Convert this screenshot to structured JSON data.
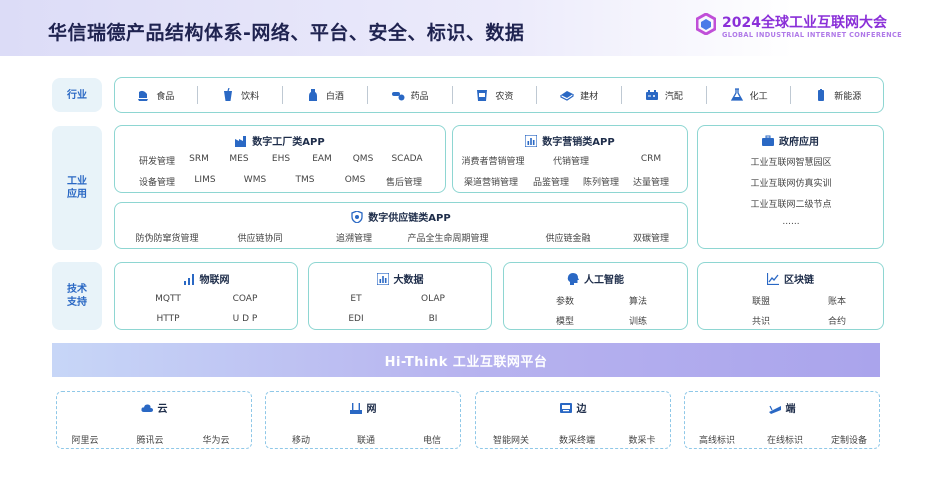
{
  "header": {
    "title": "华信瑞德产品结构体系-网络、平台、安全、标识、数据",
    "conference_title": "2024全球工业互联网大会",
    "conference_subtitle": "GLOBAL INDUSTRIAL INTERNET CONFERENCE"
  },
  "colors": {
    "accent": "#2a68c4",
    "card_border": "#8ed6d2",
    "conference": "#8a2fd8"
  },
  "industry": {
    "label": "行业",
    "items": [
      {
        "label": "食品",
        "icon": "food-icon"
      },
      {
        "label": "饮料",
        "icon": "drink-icon"
      },
      {
        "label": "白酒",
        "icon": "liquor-icon"
      },
      {
        "label": "药品",
        "icon": "medicine-icon"
      },
      {
        "label": "农资",
        "icon": "agriculture-icon"
      },
      {
        "label": "建材",
        "icon": "building-material-icon"
      },
      {
        "label": "汽配",
        "icon": "auto-parts-icon"
      },
      {
        "label": "化工",
        "icon": "chemical-icon"
      },
      {
        "label": "新能源",
        "icon": "new-energy-icon"
      }
    ]
  },
  "apps": {
    "label_line1": "工业",
    "label_line2": "应用",
    "factory": {
      "title": "数字工厂类APP",
      "row1": [
        "研发管理",
        "SRM",
        "MES",
        "EHS",
        "EAM",
        "QMS",
        "SCADA"
      ],
      "row2": [
        "设备管理",
        "LIMS",
        "WMS",
        "TMS",
        "OMS",
        "售后管理"
      ]
    },
    "marketing": {
      "title": "数字营销类APP",
      "row1": [
        "消费者营销管理",
        "代销管理",
        "CRM"
      ],
      "row2": [
        "渠道营销管理",
        "品鉴管理",
        "陈列管理",
        "达量管理"
      ]
    },
    "government": {
      "title": "政府应用",
      "items": [
        "工业互联网智慧园区",
        "工业互联网仿真实训",
        "工业互联网二级节点",
        "......"
      ]
    },
    "supply": {
      "title": "数字供应链类APP",
      "items": [
        "防伪防窜货管理",
        "供应链协同",
        "追溯管理",
        "产品全生命周期管理",
        "供应链金融",
        "双碳管理"
      ]
    }
  },
  "tech": {
    "label_line1": "技术",
    "label_line2": "支持",
    "iot": {
      "title": "物联网",
      "items": [
        "MQTT",
        "COAP",
        "HTTP",
        "U D P"
      ]
    },
    "bigdata": {
      "title": "大数据",
      "items": [
        "ET",
        "OLAP",
        "EDI",
        "BI"
      ]
    },
    "ai": {
      "title": "人工智能",
      "items": [
        "参数",
        "算法",
        "模型",
        "训练"
      ]
    },
    "blockchain": {
      "title": "区块链",
      "items": [
        "联盟",
        "账本",
        "共识",
        "合约"
      ]
    }
  },
  "platform": {
    "label": "Hi-Think 工业互联网平台"
  },
  "infra": {
    "cloud": {
      "title": "云",
      "items": [
        "阿里云",
        "腾讯云",
        "华为云"
      ]
    },
    "network": {
      "title": "网",
      "items": [
        "移动",
        "联通",
        "电信"
      ]
    },
    "edge": {
      "title": "边",
      "items": [
        "智能网关",
        "数采终端",
        "数采卡"
      ]
    },
    "terminal": {
      "title": "端",
      "items": [
        "高线标识",
        "在线标识",
        "定制设备"
      ]
    }
  }
}
